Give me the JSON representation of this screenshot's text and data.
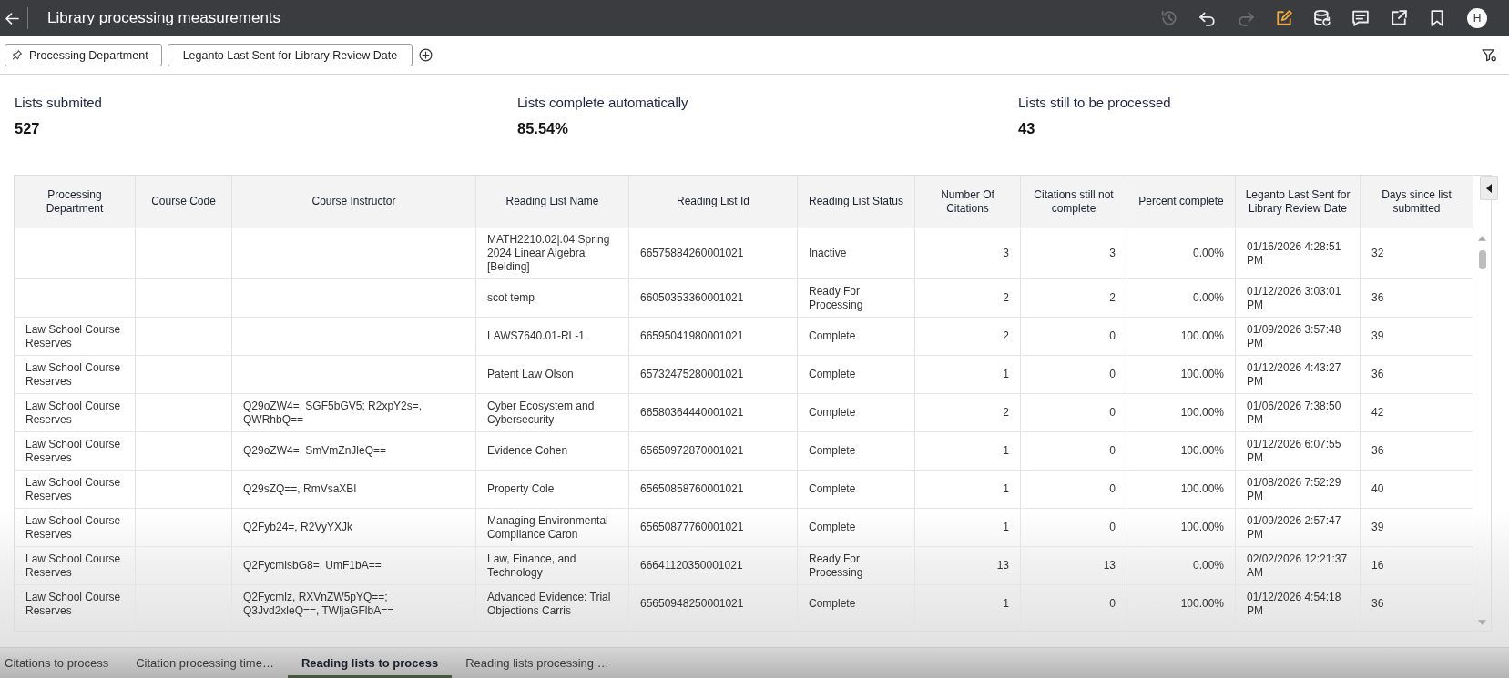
{
  "top_bar": {
    "title": "Library processing measurements",
    "actions": [
      {
        "kind": "history",
        "disabled": true
      },
      {
        "kind": "undo",
        "disabled": false
      },
      {
        "kind": "redo",
        "disabled": true
      },
      {
        "kind": "edit",
        "disabled": false
      },
      {
        "kind": "data",
        "disabled": false
      },
      {
        "kind": "comment",
        "disabled": false
      },
      {
        "kind": "export",
        "disabled": false
      },
      {
        "kind": "bookmark",
        "disabled": false
      }
    ],
    "avatar": "H"
  },
  "filter_bar": {
    "pills": [
      {
        "label": "Processing Department",
        "pinned": true
      },
      {
        "label": "Leganto Last Sent for Library Review Date",
        "pinned": false
      }
    ]
  },
  "kpis": [
    {
      "label": "Lists submited",
      "value": "527"
    },
    {
      "label": "Lists complete automatically",
      "value": "85.54%"
    },
    {
      "label": "Lists still to be processed",
      "value": "43"
    }
  ],
  "table": {
    "columns": [
      "Processing Department",
      "Course Code",
      "Course Instructor",
      "Reading List Name",
      "Reading List Id",
      "Reading List Status",
      "Number Of Citations",
      "Citations still not complete",
      "Percent complete",
      "Leganto Last Sent for Library Review Date",
      "Days since list submitted"
    ],
    "rows": [
      {
        "name": "MATH2210.02|.04 Spring 2024 Linear Algebra [Belding]",
        "id": "66575884260001021",
        "status": "Inactive",
        "citations": "3",
        "not_complete": "3",
        "percent": "0.00%",
        "last_sent": "01/16/2026 4:28:51 PM",
        "days": "32"
      },
      {
        "name": "scot temp",
        "id": "66050353360001021",
        "status": "Ready For Processing",
        "citations": "2",
        "not_complete": "2",
        "percent": "0.00%",
        "last_sent": "01/12/2026 3:03:01 PM",
        "days": "36"
      },
      {
        "department": "Law School Course Reserves",
        "name": "LAWS7640.01-RL-1",
        "id": "66595041980001021",
        "status": "Complete",
        "citations": "2",
        "not_complete": "0",
        "percent": "100.00%",
        "last_sent": "01/09/2026 3:57:48 PM",
        "days": "39"
      },
      {
        "department": "Law School Course Reserves",
        "name": "Patent Law Olson",
        "id": "65732475280001021",
        "status": "Complete",
        "citations": "1",
        "not_complete": "0",
        "percent": "100.00%",
        "last_sent": "01/12/2026 4:43:27 PM",
        "days": "36"
      },
      {
        "department": "Law School Course Reserves",
        "instructor": "Q29oZW4=, SGF5bGV5; R2xpY2s=, QWRhbQ==",
        "name": "Cyber Ecosystem and Cybersecurity",
        "id": "66580364440001021",
        "status": "Complete",
        "citations": "2",
        "not_complete": "0",
        "percent": "100.00%",
        "last_sent": "01/06/2026 7:38:50 PM",
        "days": "42"
      },
      {
        "department": "Law School Course Reserves",
        "instructor": "Q29oZW4=, SmVmZnJleQ==",
        "name": "Evidence Cohen",
        "id": "65650972870001021",
        "status": "Complete",
        "citations": "1",
        "not_complete": "0",
        "percent": "100.00%",
        "last_sent": "01/12/2026 6:07:55 PM",
        "days": "36"
      },
      {
        "department": "Law School Course Reserves",
        "instructor": "Q29sZQ==, RmVsaXBl",
        "name": "Property Cole",
        "id": "65650858760001021",
        "status": "Complete",
        "citations": "1",
        "not_complete": "0",
        "percent": "100.00%",
        "last_sent": "01/08/2026 7:52:29 PM",
        "days": "40"
      },
      {
        "department": "Law School Course Reserves",
        "instructor": "Q2Fyb24=, R2VyYXJk",
        "name": "Managing Environmental Compliance Caron",
        "id": "65650877760001021",
        "status": "Complete",
        "citations": "1",
        "not_complete": "0",
        "percent": "100.00%",
        "last_sent": "01/09/2026 2:57:47 PM",
        "days": "39"
      },
      {
        "department": "Law School Course Reserves",
        "instructor": "Q2FycmlsbG8=, UmF1bA==",
        "name": "Law, Finance, and Technology",
        "id": "66641120350001021",
        "status": "Ready For Processing",
        "citations": "13",
        "not_complete": "13",
        "percent": "0.00%",
        "last_sent": "02/02/2026 12:21:37 AM",
        "days": "16"
      },
      {
        "department": "Law School Course Reserves",
        "instructor": "Q2Fycmlz, RXVnZW5pYQ==; Q3Jvd2xleQ==, TWljaGFlbA==",
        "name": "Advanced Evidence: Trial Objections Carris",
        "id": "65650948250001021",
        "status": "Complete",
        "citations": "1",
        "not_complete": "0",
        "percent": "100.00%",
        "last_sent": "01/12/2026 4:54:18 PM",
        "days": "36"
      }
    ]
  },
  "bottom_tabs": [
    {
      "label": "Citations to process",
      "selected": false
    },
    {
      "label": "Citation processing time…",
      "selected": false
    },
    {
      "label": "Reading lists to process",
      "selected": true
    },
    {
      "label": "Reading lists processing …",
      "selected": false
    }
  ]
}
